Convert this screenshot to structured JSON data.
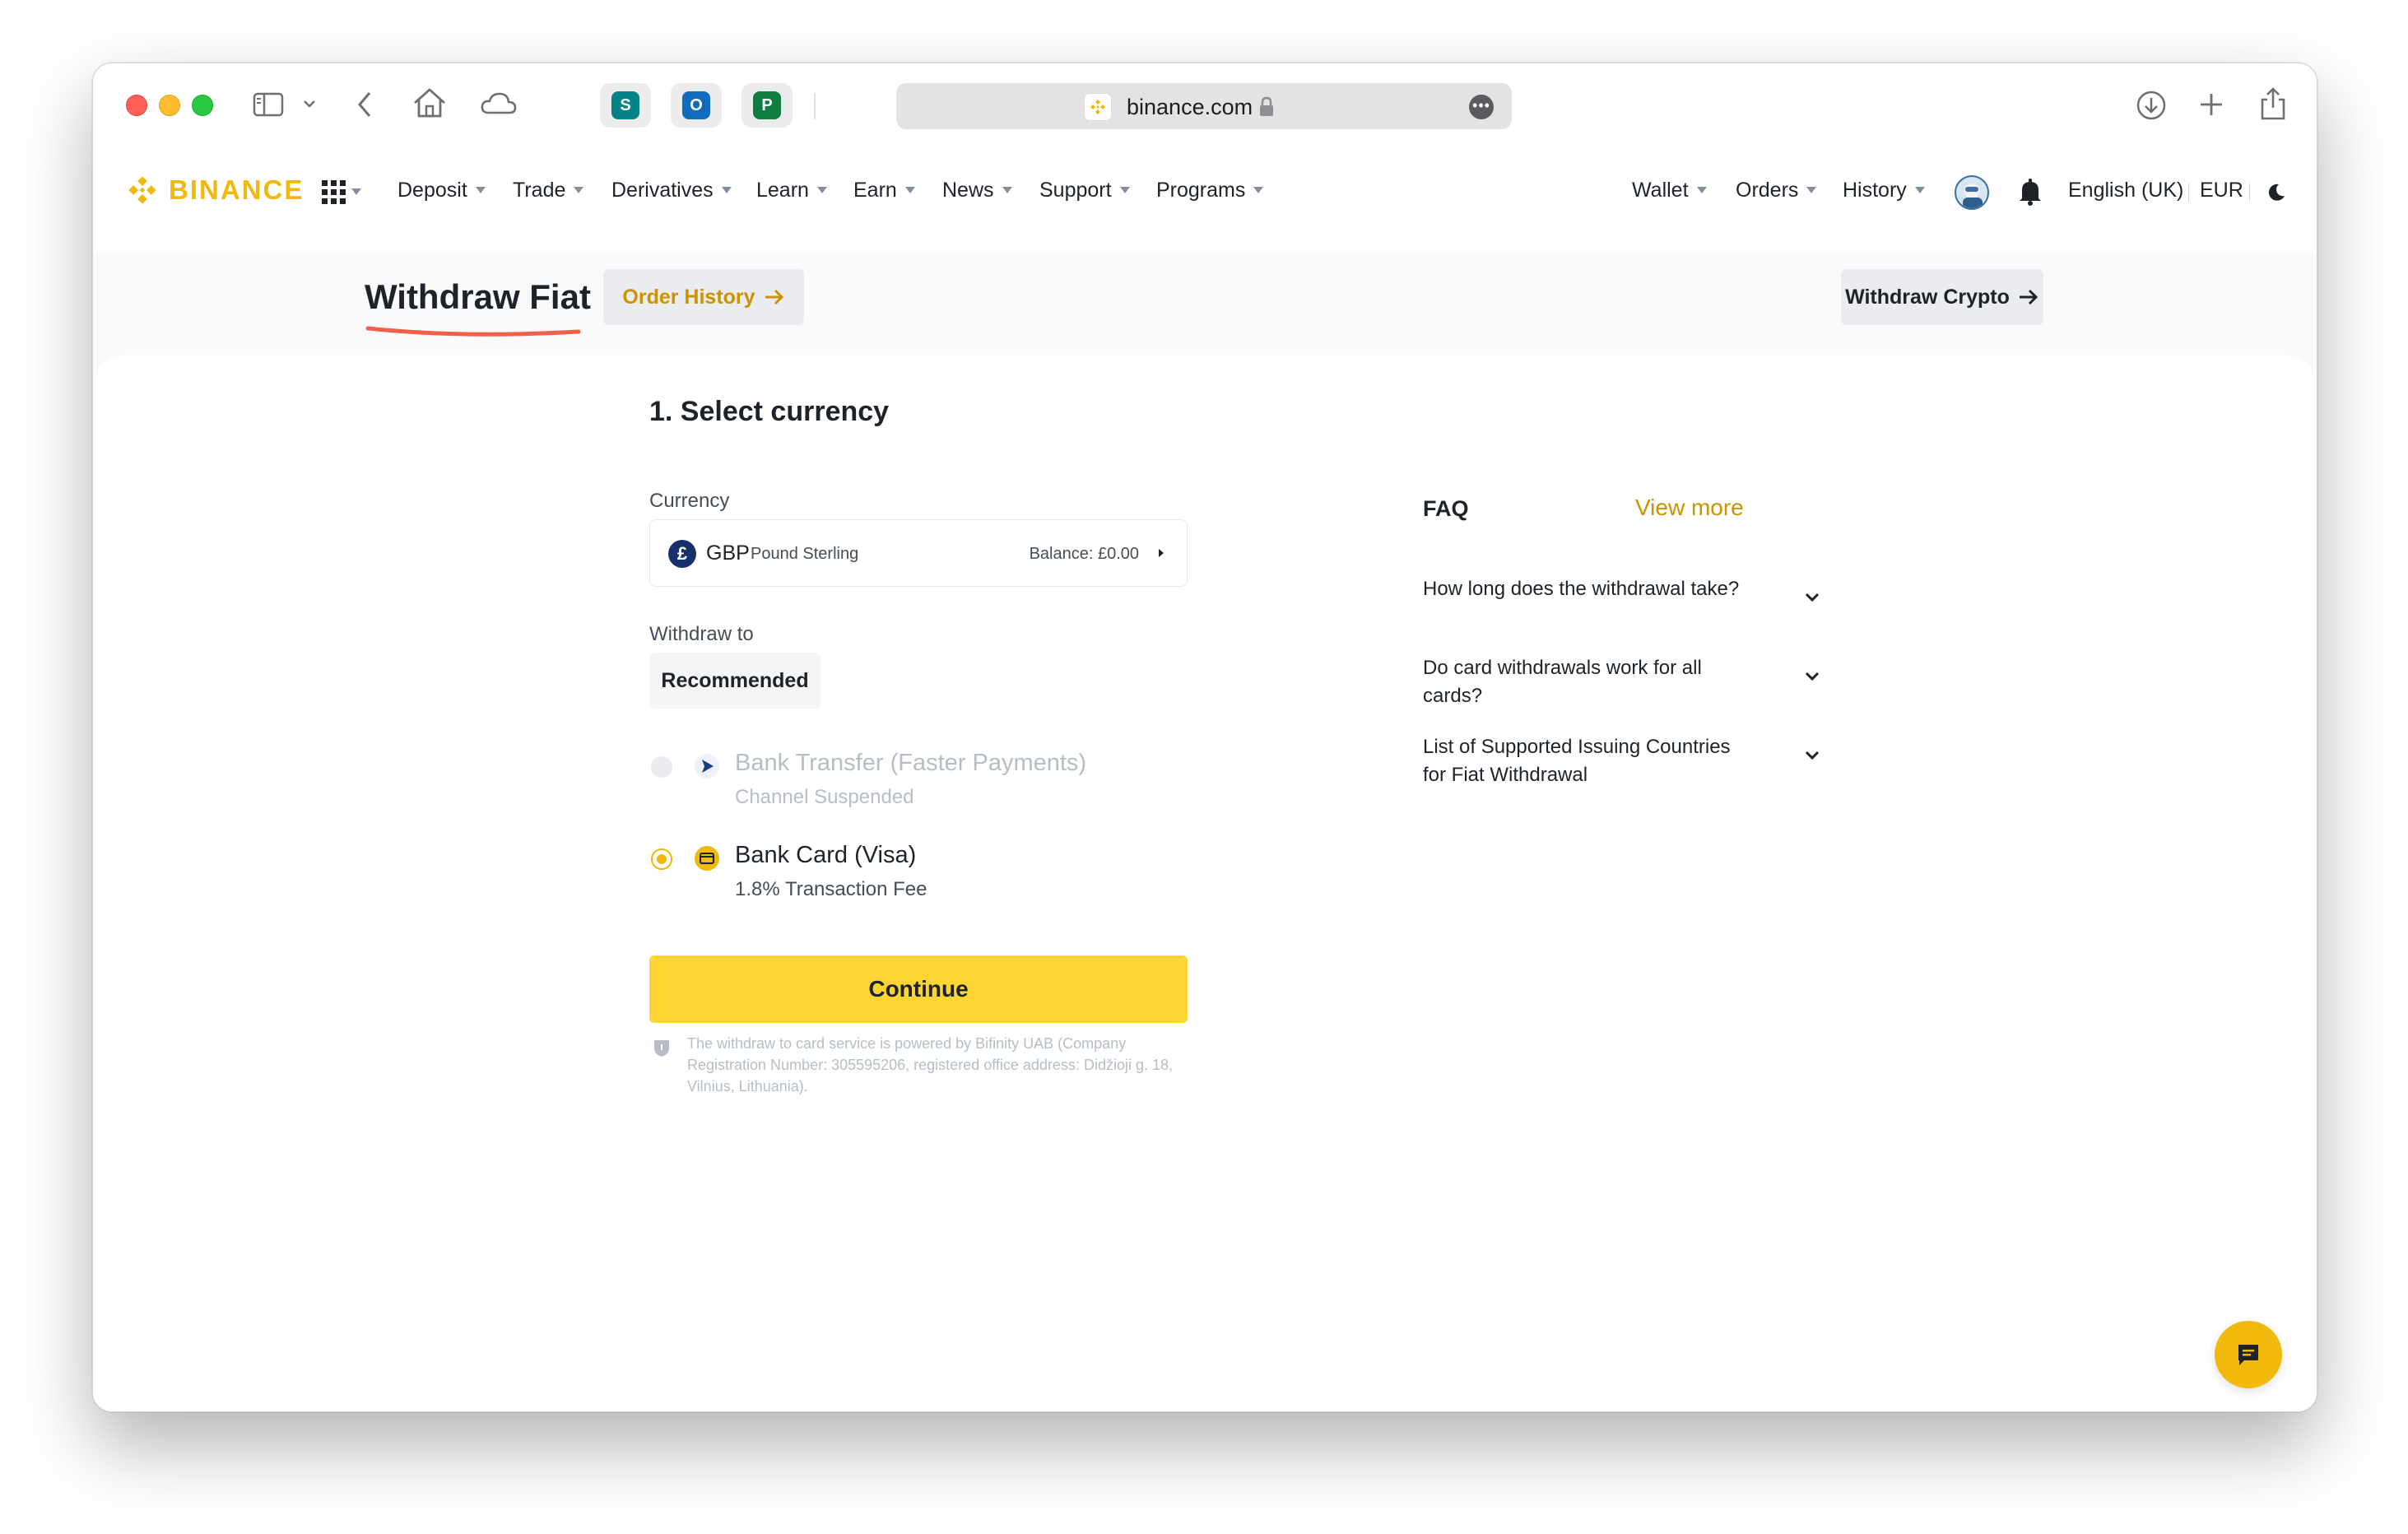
{
  "browser": {
    "url": "binance.com"
  },
  "nav": {
    "logo_text": "BINANCE",
    "items": [
      "Deposit",
      "Trade",
      "Derivatives",
      "Learn",
      "Earn",
      "News",
      "Support",
      "Programs"
    ],
    "right": {
      "wallet": "Wallet",
      "orders": "Orders",
      "history": "History",
      "language": "English (UK)",
      "currency": "EUR"
    }
  },
  "header": {
    "title": "Withdraw Fiat",
    "order_history": "Order History",
    "withdraw_crypto": "Withdraw Crypto"
  },
  "form": {
    "step_title": "1. Select currency",
    "currency_label": "Currency",
    "currency_code": "GBP",
    "currency_name": "Pound Sterling",
    "balance": "Balance: £0.00",
    "withdraw_to_label": "Withdraw to",
    "recommended": "Recommended",
    "options": [
      {
        "title": "Bank Transfer (Faster Payments)",
        "subtitle": "Channel Suspended",
        "selected": false,
        "disabled": true
      },
      {
        "title": "Bank Card (Visa)",
        "subtitle": "1.8% Transaction Fee",
        "selected": true,
        "disabled": false
      }
    ],
    "continue": "Continue",
    "disclaimer": "The withdraw to card service is powered by Bifinity UAB (Company Registration Number: 305595206, registered office address: Didžioji g. 18, Vilnius, Lithuania)."
  },
  "faq": {
    "title": "FAQ",
    "view_more": "View more",
    "items": [
      "How long does the withdrawal take?",
      "Do card withdrawals work for all cards?",
      "List of Supported Issuing Countries for Fiat Withdrawal"
    ]
  },
  "colors": {
    "brand": "#f0b90b",
    "button": "#fcd535",
    "link": "#c99400",
    "text": "#1e2329",
    "muted": "#b7bdc6"
  }
}
